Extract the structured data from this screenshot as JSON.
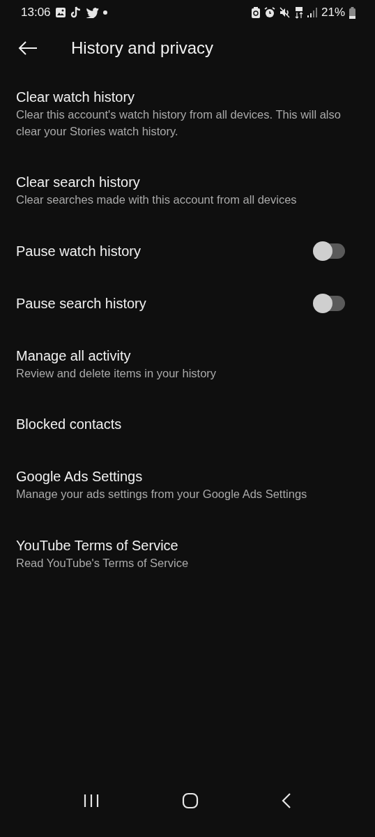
{
  "status_bar": {
    "time": "13:06",
    "battery": "21%"
  },
  "header": {
    "title": "History and privacy"
  },
  "items": [
    {
      "kind": "link",
      "title": "Clear watch history",
      "subtitle": "Clear this account's watch history from all devices. This will also clear your Stories watch history."
    },
    {
      "kind": "link",
      "title": "Clear search history",
      "subtitle": "Clear searches made with this account from all devices"
    },
    {
      "kind": "toggle",
      "title": "Pause watch history",
      "on": false
    },
    {
      "kind": "toggle",
      "title": "Pause search history",
      "on": false
    },
    {
      "kind": "link",
      "title": "Manage all activity",
      "subtitle": "Review and delete items in your history"
    },
    {
      "kind": "link",
      "title": "Blocked contacts"
    },
    {
      "kind": "link",
      "title": "Google Ads Settings",
      "subtitle": "Manage your ads settings from your Google Ads Settings"
    },
    {
      "kind": "link",
      "title": "YouTube Terms of Service",
      "subtitle": "Read YouTube's Terms of Service"
    }
  ]
}
